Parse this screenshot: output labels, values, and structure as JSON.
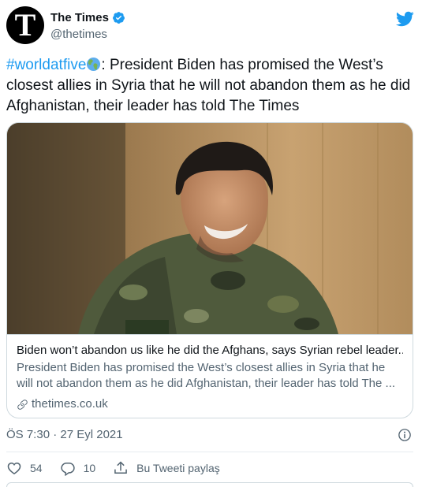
{
  "author": {
    "avatar_letter": "T",
    "display_name": "The Times",
    "handle": "@thetimes"
  },
  "tweet": {
    "hashtag": "#worldatfive",
    "body": ": President Biden has promised the West’s closest allies in Syria that he will not abandon them as he did Afghanistan, their leader has told The Times"
  },
  "card": {
    "title": "Biden won’t abandon us like he did the Afghans, says Syrian rebel leader...",
    "description": "President Biden has promised the West’s closest allies in Syria that he will not abandon them as he did Afghanistan, their leader has told The ...",
    "domain": "thetimes.co.uk"
  },
  "meta": {
    "timestamp": "ÖS 7:30 · 27 Eyl 2021"
  },
  "actions": {
    "like_count": "54",
    "reply_count": "10",
    "share_label": "Bu Tweeti paylaş"
  },
  "colors": {
    "accent": "#1d9bf0",
    "text_secondary": "#536471",
    "border": "#cfd9de"
  }
}
